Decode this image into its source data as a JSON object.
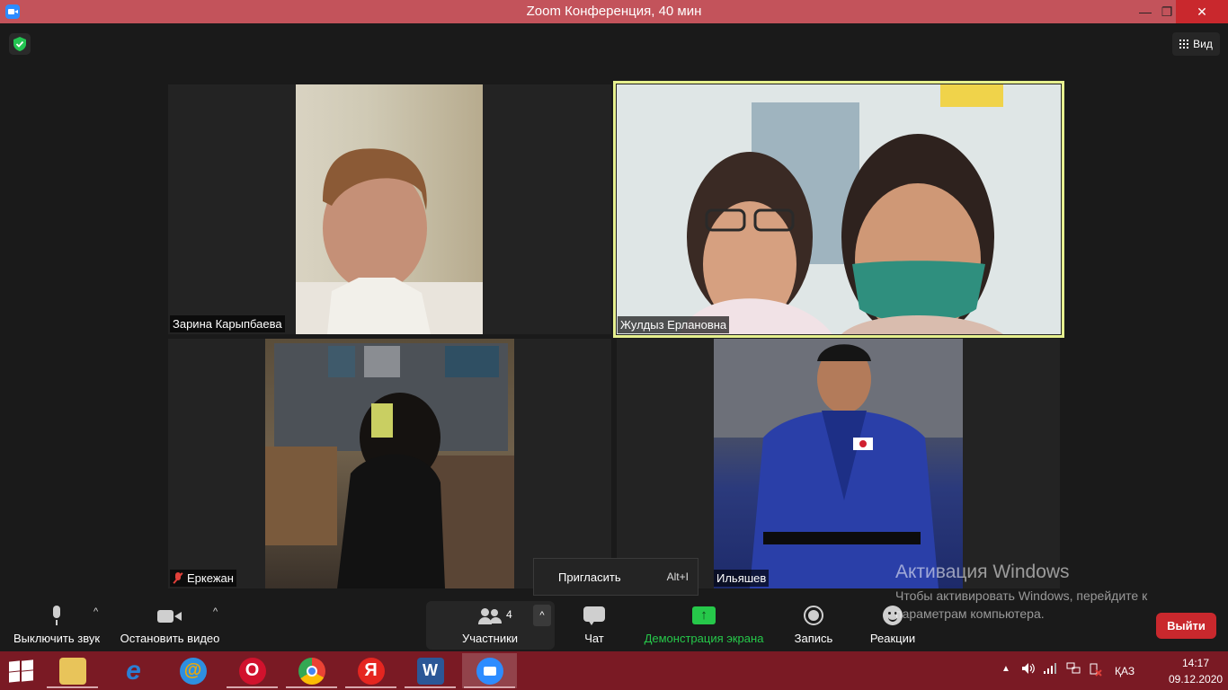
{
  "window": {
    "title": "Zoom Конференция, 40 мин",
    "minimize_glyph": "—",
    "maximize_glyph": "❐",
    "close_glyph": "✕"
  },
  "header": {
    "view_label": "Вид",
    "shield_icon": "shield-check-icon",
    "shield_color": "#23c552"
  },
  "tiles": [
    {
      "name": "Зарина Карыпбаева",
      "muted": false,
      "speaking": false
    },
    {
      "name": "Жулдыз Ерлановна",
      "muted": false,
      "speaking": true
    },
    {
      "name": "Еркежан",
      "muted": true,
      "speaking": false
    },
    {
      "name": "Ильяшев",
      "muted": false,
      "speaking": false
    }
  ],
  "invite_menu": {
    "label": "Пригласить",
    "shortcut": "Alt+I"
  },
  "toolbar": {
    "mute_label": "Выключить звук",
    "video_label": "Остановить видео",
    "participants_label": "Участники",
    "participants_count": "4",
    "chat_label": "Чат",
    "share_label": "Демонстрация экрана",
    "record_label": "Запись",
    "reactions_label": "Реакции",
    "leave_label": "Выйти",
    "caret_glyph": "^",
    "share_color": "#26c84a",
    "leave_color": "#c9282d"
  },
  "watermark": {
    "title": "Активация Windows",
    "text": "Чтобы активировать Windows, перейдите к параметрам компьютера."
  },
  "taskbar": {
    "apps": [
      {
        "name": "file-explorer",
        "glyph": "",
        "color": "#e8c45a"
      },
      {
        "name": "internet-explorer",
        "glyph": "e",
        "color": "#2a7fd4"
      },
      {
        "name": "mail-ru-agent",
        "glyph": "@",
        "color": "#2e8fe0"
      },
      {
        "name": "opera",
        "glyph": "O",
        "color": "#d1122d"
      },
      {
        "name": "chrome",
        "glyph": "",
        "color": "#4285f4"
      },
      {
        "name": "yandex-browser",
        "glyph": "Я",
        "color": "#e52620"
      },
      {
        "name": "word",
        "glyph": "W",
        "color": "#2b5797"
      },
      {
        "name": "zoom",
        "glyph": "",
        "color": "#2d8cff"
      }
    ],
    "language": "ҚАЗ",
    "time": "14:17",
    "date": "09.12.2020"
  }
}
